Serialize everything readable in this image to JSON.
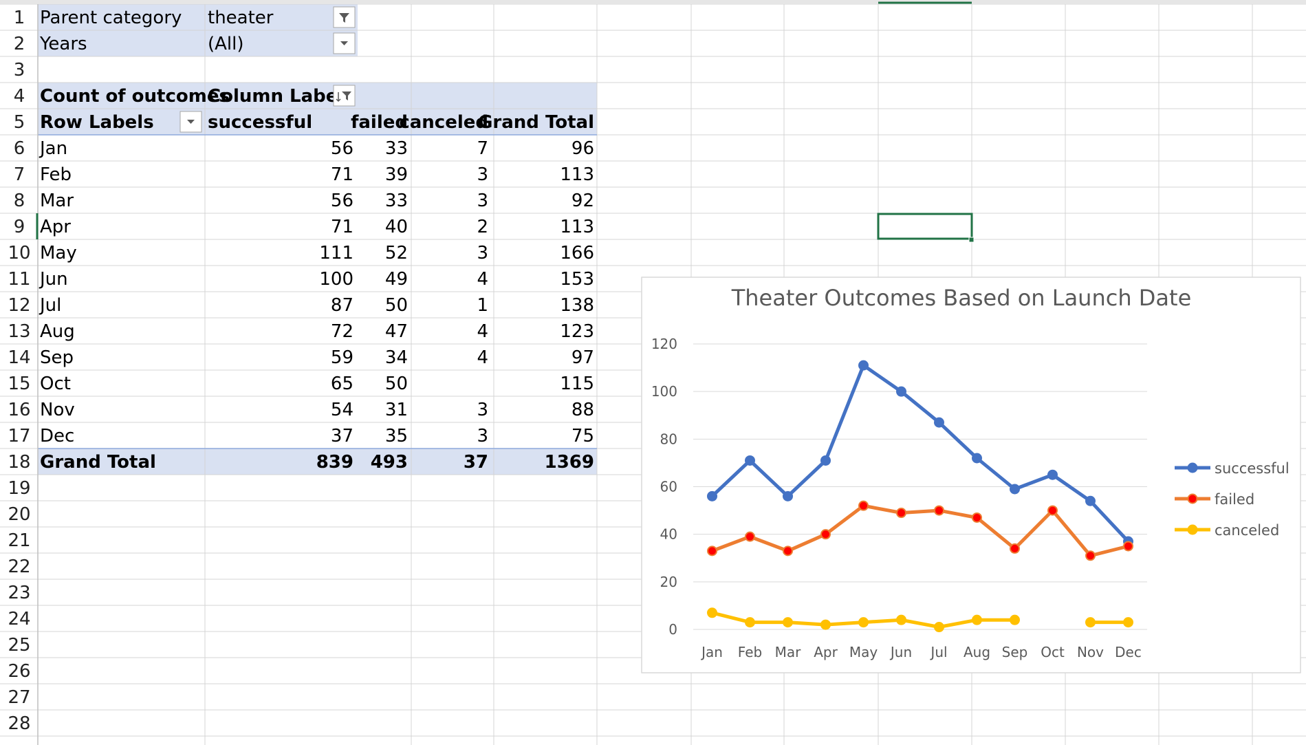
{
  "filters": [
    {
      "label": "Parent category",
      "value": "theater",
      "icon": "filter-active-icon"
    },
    {
      "label": "Years",
      "value": "(All)",
      "icon": "dropdown-icon"
    }
  ],
  "pivot": {
    "corner_label": "Count of outcomes",
    "column_labels": "Column Labels",
    "row_labels": "Row Labels",
    "columns": [
      "successful",
      "failed",
      "canceled",
      "Grand Total"
    ],
    "rows": [
      {
        "label": "Jan",
        "values": [
          "56",
          "33",
          "7",
          "96"
        ]
      },
      {
        "label": "Feb",
        "values": [
          "71",
          "39",
          "3",
          "113"
        ]
      },
      {
        "label": "Mar",
        "values": [
          "56",
          "33",
          "3",
          "92"
        ]
      },
      {
        "label": "Apr",
        "values": [
          "71",
          "40",
          "2",
          "113"
        ]
      },
      {
        "label": "May",
        "values": [
          "111",
          "52",
          "3",
          "166"
        ]
      },
      {
        "label": "Jun",
        "values": [
          "100",
          "49",
          "4",
          "153"
        ]
      },
      {
        "label": "Jul",
        "values": [
          "87",
          "50",
          "1",
          "138"
        ]
      },
      {
        "label": "Aug",
        "values": [
          "72",
          "47",
          "4",
          "123"
        ]
      },
      {
        "label": "Sep",
        "values": [
          "59",
          "34",
          "4",
          "97"
        ]
      },
      {
        "label": "Oct",
        "values": [
          "65",
          "50",
          "",
          "115"
        ]
      },
      {
        "label": "Nov",
        "values": [
          "54",
          "31",
          "3",
          "88"
        ]
      },
      {
        "label": "Dec",
        "values": [
          "37",
          "35",
          "3",
          "75"
        ]
      }
    ],
    "grand_total": {
      "label": "Grand Total",
      "values": [
        "839",
        "493",
        "37",
        "1369"
      ]
    }
  },
  "row_numbers": [
    "1",
    "2",
    "3",
    "4",
    "5",
    "6",
    "7",
    "8",
    "9",
    "10",
    "11",
    "12",
    "13",
    "14",
    "15",
    "16",
    "17",
    "18",
    "19",
    "20",
    "21",
    "22",
    "23",
    "24",
    "25",
    "26",
    "27",
    "28"
  ],
  "selected_row": "9",
  "colors": {
    "pivot_header": "#d9e1f2",
    "gridline": "#d4d4d4",
    "selection": "#217346",
    "successful": "#4472c4",
    "failed": "#ed7d31",
    "failed_marker": "#ff0000",
    "canceled": "#ffc000"
  },
  "chart_data": {
    "type": "line",
    "title": "Theater Outcomes Based on Launch Date",
    "categories": [
      "Jan",
      "Feb",
      "Mar",
      "Apr",
      "May",
      "Jun",
      "Jul",
      "Aug",
      "Sep",
      "Oct",
      "Nov",
      "Dec"
    ],
    "series": [
      {
        "name": "successful",
        "values": [
          56,
          71,
          56,
          71,
          111,
          100,
          87,
          72,
          59,
          65,
          54,
          37
        ]
      },
      {
        "name": "failed",
        "values": [
          33,
          39,
          33,
          40,
          52,
          49,
          50,
          47,
          34,
          50,
          31,
          35
        ]
      },
      {
        "name": "canceled",
        "values": [
          7,
          3,
          3,
          2,
          3,
          4,
          1,
          4,
          4,
          null,
          3,
          3
        ]
      }
    ],
    "yticks": [
      "0",
      "20",
      "40",
      "60",
      "80",
      "100",
      "120"
    ],
    "ylim": [
      0,
      120
    ],
    "grid": true,
    "legend": "right",
    "markers": true
  }
}
